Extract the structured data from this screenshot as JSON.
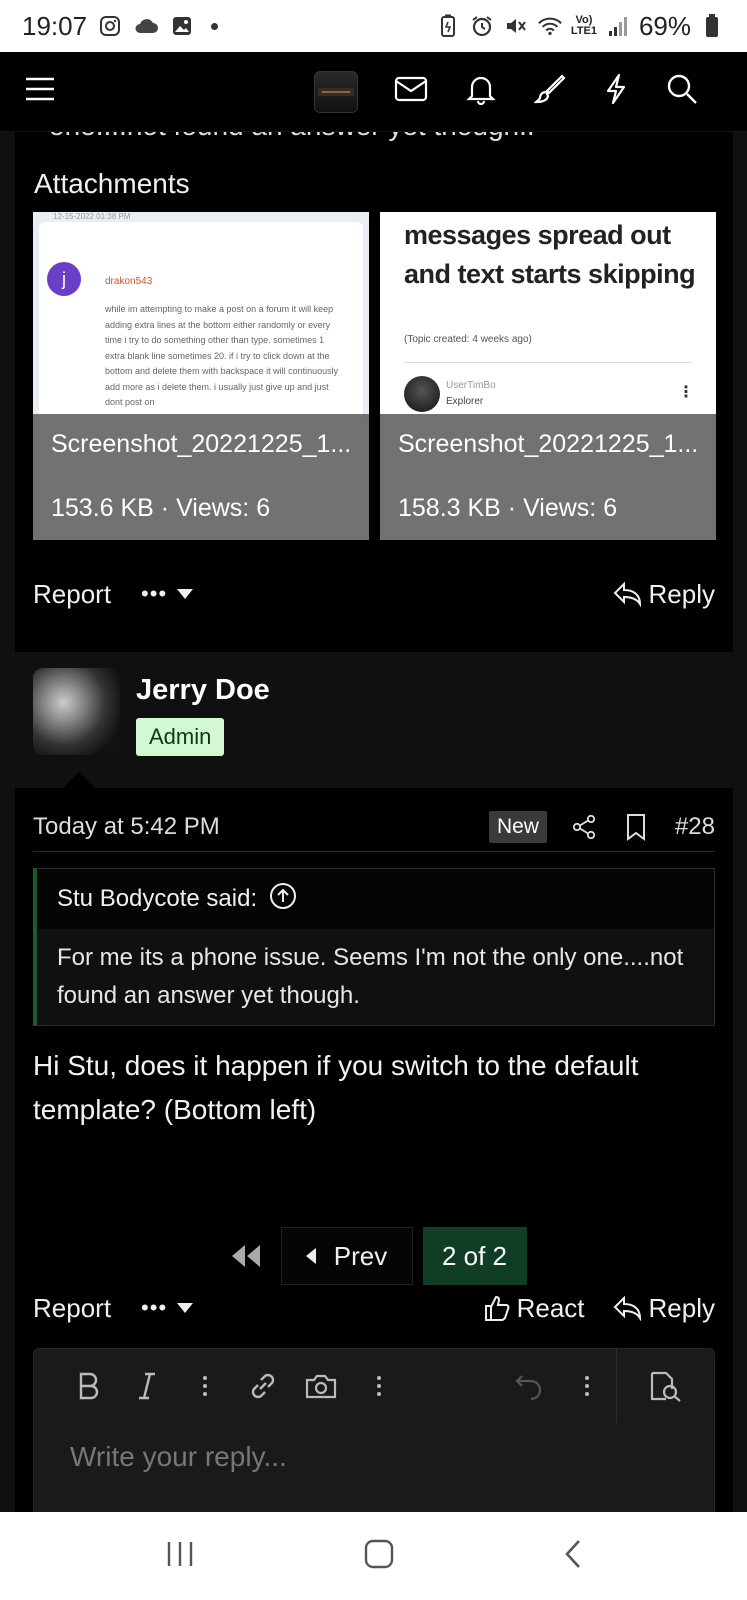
{
  "status": {
    "time": "19:07",
    "battery": "69%",
    "network": "Vo)\nLTE1"
  },
  "thread": {
    "cut_text": "one....not found an answer yet though..",
    "attachments_title": "Attachments",
    "attachments": [
      {
        "filename": "Screenshot_20221225_1...",
        "meta": "153.6 KB · Views: 6",
        "preview": {
          "top": "12-15-2022 01:38 PM",
          "username": "drakon543",
          "text": "while im attempting to make a post on a forum it will keep adding extra lines at the bottom either randomly or every time i try to do something other than type. sometimes 1 extra blank line sometimes 20. if i try to click down at the bottom and delete them with backspace it will continuously add more as i delete them. i usually just give up and just dont post on",
          "avatar_letter": "j"
        }
      },
      {
        "filename": "Screenshot_20221225_1...",
        "meta": "158.3 KB · Views: 6",
        "preview": {
          "headline": "messages spread out and text starts skipping",
          "topic": "(Topic created: 4 weeks ago)",
          "username": "UserTimBo",
          "role": "Explorer"
        }
      }
    ],
    "post1_actions": {
      "report": "Report",
      "more": "•••",
      "reply": "Reply"
    },
    "post2": {
      "username": "Jerry Doe",
      "badge": "Admin",
      "time": "Today at 5:42 PM",
      "new_badge": "New",
      "number": "#28",
      "quote_author": "Stu Bodycote said:",
      "quote_text": "For me its a phone issue. Seems I'm not the only one....not found an answer yet though.",
      "message": "Hi Stu, does it happen if you switch to the default template? (Bottom left)",
      "actions": {
        "report": "Report",
        "more": "•••",
        "react": "React",
        "reply": "Reply"
      }
    },
    "pager": {
      "prev": "Prev",
      "current": "2 of 2"
    },
    "editor": {
      "placeholder": "Write your reply..."
    }
  },
  "colors": {
    "accent_green": "#0f3d25",
    "admin_badge": "#d4f7d4",
    "quote_bar": "#1f5a2f"
  }
}
